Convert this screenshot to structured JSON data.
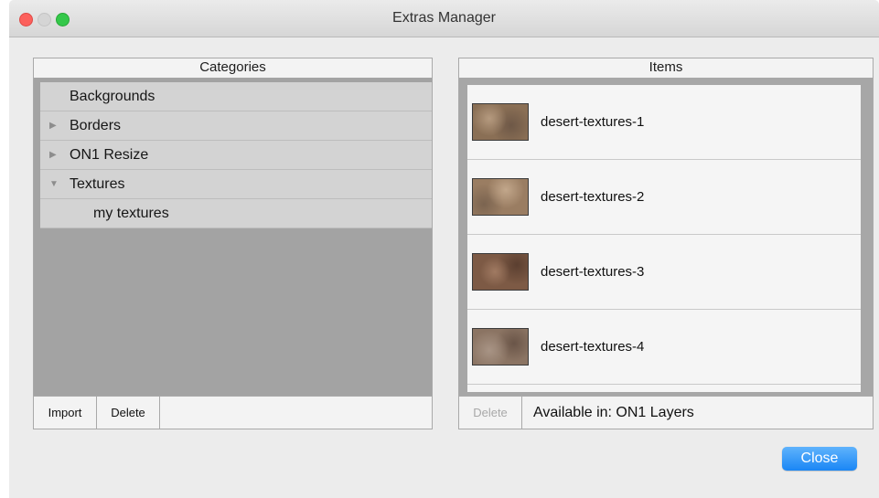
{
  "window": {
    "title": "Extras Manager"
  },
  "categories": {
    "header": "Categories",
    "items": [
      {
        "label": "Backgrounds",
        "arrow": ""
      },
      {
        "label": "Borders",
        "arrow": "▶"
      },
      {
        "label": "ON1 Resize",
        "arrow": "▶"
      },
      {
        "label": "Textures",
        "arrow": "▼"
      },
      {
        "label": "my textures",
        "arrow": ""
      }
    ],
    "import_label": "Import",
    "delete_label": "Delete"
  },
  "items": {
    "header": "Items",
    "list": [
      {
        "name": "desert-textures-1",
        "thumb_color": "#8a6f55"
      },
      {
        "name": "desert-textures-2",
        "thumb_color": "#9a7d62"
      },
      {
        "name": "desert-textures-3",
        "thumb_color": "#7d5a45"
      },
      {
        "name": "desert-textures-4",
        "thumb_color": "#8b7463"
      }
    ],
    "delete_label": "Delete",
    "available_in": "Available in: ON1 Layers"
  },
  "footer": {
    "close_label": "Close"
  },
  "colors": {
    "accent": "#1a86f5"
  }
}
